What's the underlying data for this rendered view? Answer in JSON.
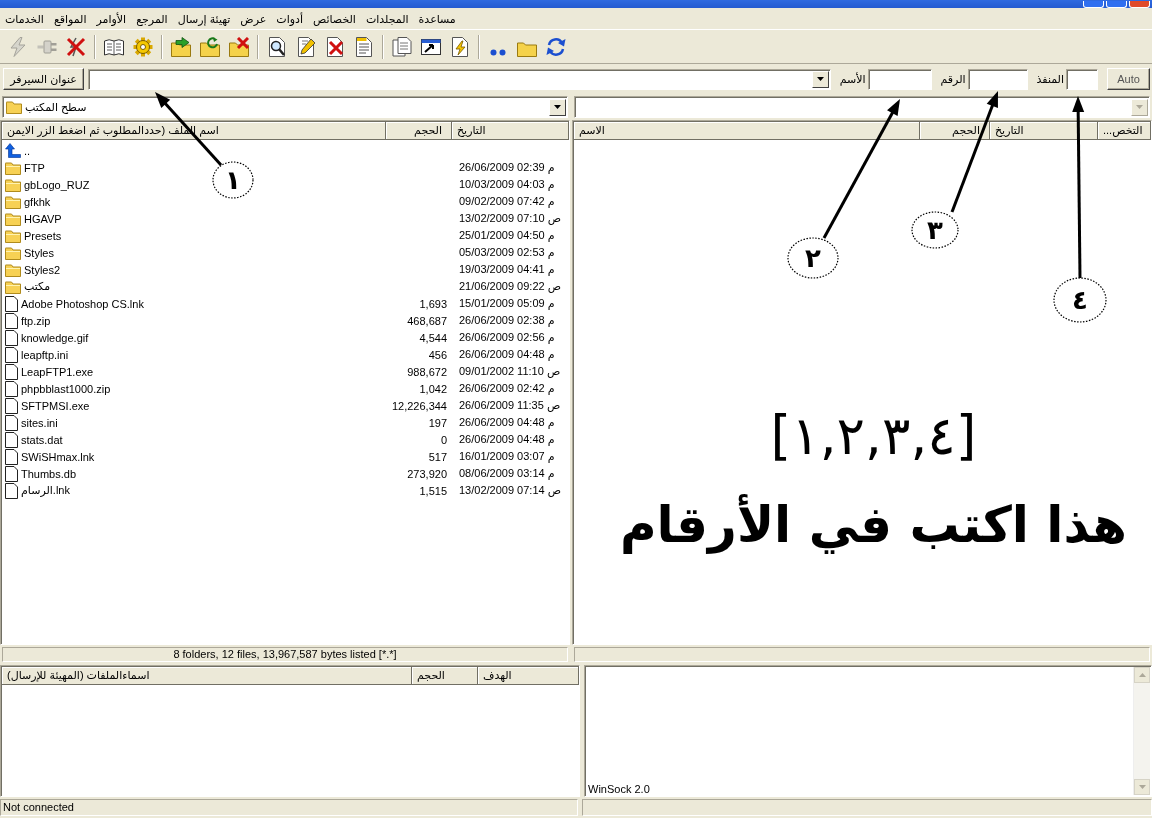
{
  "menu": [
    "مساعدة",
    "المجلدات",
    "الخصائص",
    "أدوات",
    "عرض",
    "تهيئة إرسال",
    "المرجع",
    "الأوامر",
    "المواقع",
    "الخدمات"
  ],
  "toolbar": [
    [
      {
        "disabled": true
      },
      {
        "disabled": true
      },
      {
        "disabled": false
      }
    ],
    [
      {
        "disabled": false
      },
      {
        "disabled": false
      }
    ],
    [
      {
        "disabled": false
      },
      {
        "disabled": false
      },
      {
        "disabled": false
      }
    ],
    [
      {
        "disabled": false
      },
      {
        "disabled": false
      },
      {
        "disabled": false
      },
      {
        "disabled": false
      }
    ],
    [
      {
        "disabled": false
      },
      {
        "disabled": false
      },
      {
        "disabled": false
      }
    ],
    [
      {
        "disabled": false
      },
      {
        "disabled": false
      },
      {
        "disabled": false
      }
    ]
  ],
  "server_bar": {
    "server_button": "عنوان السيرفر",
    "name_label": "الأسم",
    "number_label": "الرقم",
    "port_label": "المنفذ",
    "auto_button": "Auto"
  },
  "local_pane": {
    "path": "سطح المكتب",
    "columns": [
      "التاريخ",
      "الحجم",
      "اسم الملف (حددالمطلوب ثم اضغط الزر الايمن"
    ],
    "rows": [
      {
        "kind": "up",
        "name": ".."
      },
      {
        "kind": "folder",
        "name": "FTP",
        "date": "26/06/2009 02:39 م"
      },
      {
        "kind": "folder",
        "name": "gbLogo_RUZ",
        "date": "10/03/2009 04:03 م"
      },
      {
        "kind": "folder",
        "name": "gfkhk",
        "date": "09/02/2009 07:42 م"
      },
      {
        "kind": "folder",
        "name": "HGAVP",
        "date": "13/02/2009 07:10 ص"
      },
      {
        "kind": "folder",
        "name": "Presets",
        "date": "25/01/2009 04:50 م"
      },
      {
        "kind": "folder",
        "name": "Styles",
        "date": "05/03/2009 02:53 م"
      },
      {
        "kind": "folder",
        "name": "Styles2",
        "date": "19/03/2009 04:41 م"
      },
      {
        "kind": "folder",
        "name": "مكتب",
        "date": "21/06/2009 09:22 ص"
      },
      {
        "kind": "file",
        "name": "Adobe Photoshop CS.lnk",
        "size": "1,693",
        "date": "15/01/2009 05:09 م"
      },
      {
        "kind": "file",
        "name": "ftp.zip",
        "size": "468,687",
        "date": "26/06/2009 02:38 م"
      },
      {
        "kind": "file",
        "name": "knowledge.gif",
        "size": "4,544",
        "date": "26/06/2009 02:56 م"
      },
      {
        "kind": "file",
        "name": "leapftp.ini",
        "size": "456",
        "date": "26/06/2009 04:48 م"
      },
      {
        "kind": "file",
        "name": "LeapFTP1.exe",
        "size": "988,672",
        "date": "09/01/2002 11:10 ص"
      },
      {
        "kind": "file",
        "name": "phpbblast1000.zip",
        "size": "1,042",
        "date": "26/06/2009 02:42 م"
      },
      {
        "kind": "file",
        "name": "SFTPMSI.exe",
        "size": "12,226,344",
        "date": "26/06/2009 11:35 ص"
      },
      {
        "kind": "file",
        "name": "sites.ini",
        "size": "197",
        "date": "26/06/2009 04:48 م"
      },
      {
        "kind": "file",
        "name": "stats.dat",
        "size": "0",
        "date": "26/06/2009 04:48 م"
      },
      {
        "kind": "file",
        "name": "SWiSHmax.lnk",
        "size": "517",
        "date": "16/01/2009 03:07 م"
      },
      {
        "kind": "file",
        "name": "Thumbs.db",
        "size": "273,920",
        "date": "08/06/2009 03:14 م"
      },
      {
        "kind": "file",
        "name": "الرسام.lnk",
        "size": "1,515",
        "date": "13/02/2009 07:14 ص"
      }
    ],
    "status": "8 folders, 12 files, 13,967,587 bytes listed [*.*]"
  },
  "remote_pane": {
    "path_field": {
      "disabled": true
    },
    "columns": [
      "التخص...",
      "التاريخ",
      "الحجم",
      "الاسم"
    ]
  },
  "queue": {
    "columns": [
      "الهدف",
      "الحجم",
      "اسماءالملفات (المهيئة للإرسال)"
    ]
  },
  "log": {
    "lines": [
      "WinSock 2.0"
    ]
  },
  "status_bar": {
    "connection": "Not connected"
  },
  "annotations": {
    "callouts": [
      {
        "number": "١"
      },
      {
        "number": "٢"
      },
      {
        "number": "٣"
      },
      {
        "number": "٤"
      }
    ],
    "caption": [
      "[١,٢,٣,٤]",
      "هذا اكتب في الأرقام"
    ]
  }
}
